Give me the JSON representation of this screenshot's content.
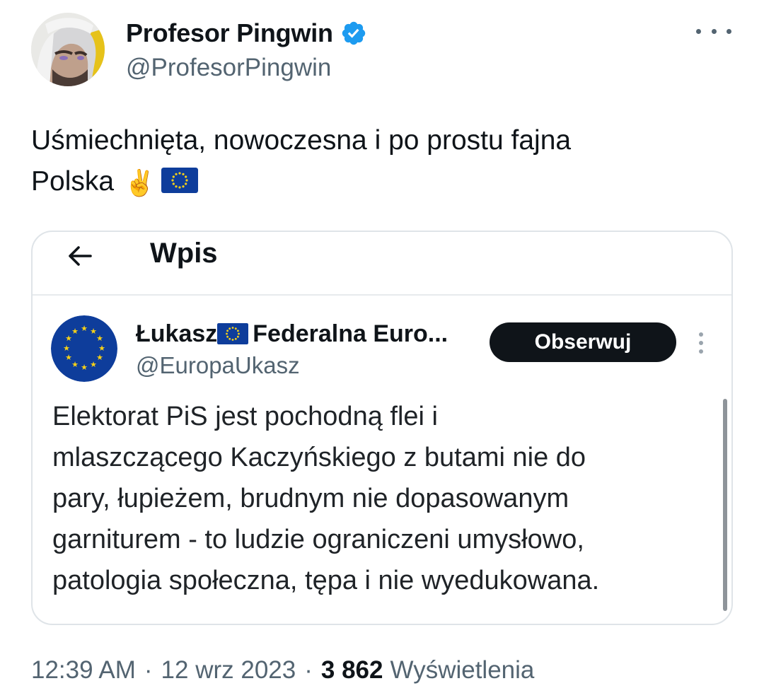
{
  "author": {
    "display_name": "Profesor Pingwin",
    "handle": "@ProfesorPingwin",
    "verified": true,
    "verified_color": "#1d9bf0"
  },
  "tweet": {
    "text_line1": "Uśmiechnięta, nowoczesna i po prostu fajna",
    "text_line2": "Polska",
    "emoji_victory": "✌️",
    "emoji_flag": "eu-flag-icon"
  },
  "quoted": {
    "header_title": "Wpis",
    "display_name": "Łukasz",
    "display_name_rest": "Federalna Euro...",
    "handle": "@EuropaUkasz",
    "follow_label": "Obserwuj",
    "text_lines": [
      "Elektorat PiS jest pochodną flei i",
      "mlaszczącego  Kaczyńskiego z butami nie do",
      "pary, łupieżem, brudnym nie dopasowanym",
      "garniturem - to ludzie ograniczeni umysłowo,",
      "patologia społeczna, tępa i nie wyedukowana."
    ]
  },
  "meta": {
    "time": "12:39 AM",
    "separator": "·",
    "date": "12 wrz 2023",
    "views_count": "3 862",
    "views_label": "Wyświetlenia"
  },
  "colors": {
    "eu_blue": "#0e3d9b",
    "eu_star": "#f7d117",
    "text_primary": "#0f1419",
    "text_secondary": "#536471"
  }
}
